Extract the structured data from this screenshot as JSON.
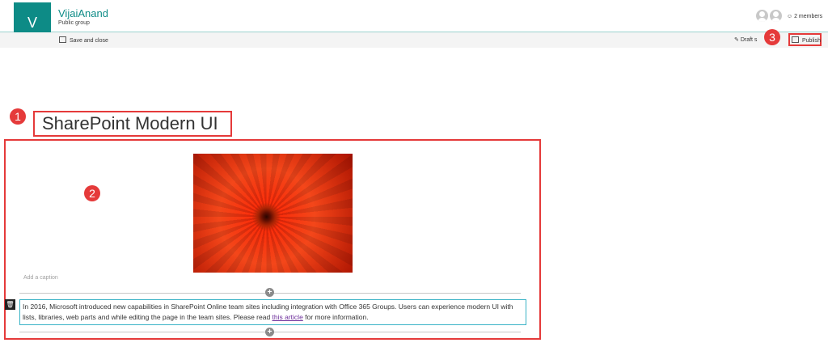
{
  "header": {
    "logo_letter": "V",
    "site_title": "VijaiAnand",
    "site_subtitle": "Public group",
    "members": "2 members"
  },
  "commandbar": {
    "save_close": "Save and close",
    "draft": "Draft s",
    "publish": "Publish"
  },
  "markers": [
    "1",
    "2",
    "3"
  ],
  "page": {
    "title": "SharePoint Modern UI",
    "caption_placeholder": "Add a caption",
    "body_part1": "In 2016, Microsoft introduced new capabilities in SharePoint Online team sites including integration with Office 365 Groups. Users can experience modern UI with lists, libraries, web parts and while editing the page in the team sites. Please read ",
    "link_text": "this article",
    "body_part2": " for more information."
  },
  "colors": {
    "accent": "#0d8b86",
    "annotation_red": "#e53a3a",
    "link": "#6b2c9a"
  }
}
